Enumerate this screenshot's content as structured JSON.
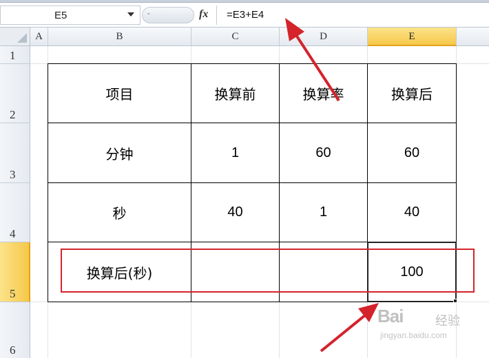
{
  "formula_bar": {
    "name_box": "E5",
    "fx_icon": "fx",
    "formula": "=E3+E4"
  },
  "columns": [
    "A",
    "B",
    "C",
    "D",
    "E"
  ],
  "active_column": "E",
  "rows": [
    "1",
    "2",
    "3",
    "4",
    "5",
    "6"
  ],
  "active_row": "5",
  "table": {
    "header": [
      "项目",
      "换算前",
      "换算率",
      "换算后"
    ],
    "rows": [
      [
        "分钟",
        "1",
        "60",
        "60"
      ],
      [
        "秒",
        "40",
        "1",
        "40"
      ],
      [
        "换算后(秒)",
        "",
        "",
        "100"
      ]
    ]
  },
  "watermark": {
    "logo": "Bai",
    "text": "经验",
    "url": "jingyan.baidu.com"
  },
  "colors": {
    "annotation": "#d4232b",
    "active_header": "#f6c84a"
  }
}
